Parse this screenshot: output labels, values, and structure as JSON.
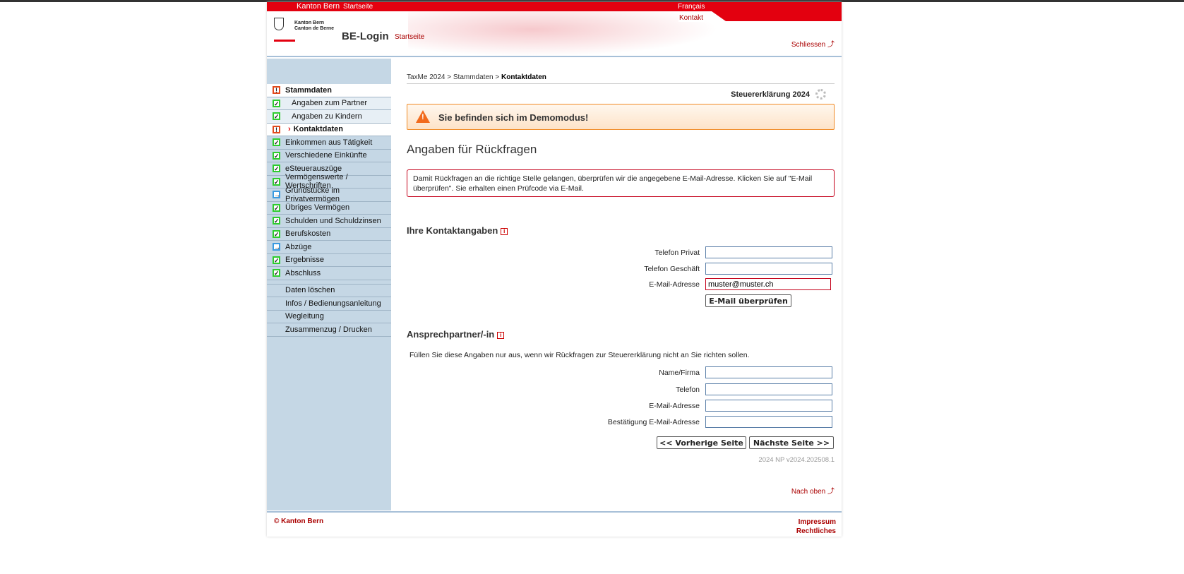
{
  "header": {
    "kanton": "Kanton Bern",
    "startseite": "Startseite",
    "language": "Français",
    "kontakt": "Kontakt",
    "logo_text_1": "Kanton Bern",
    "logo_text_2": "Canton de Berne",
    "app": "BE-Login",
    "app_start": "Startseite",
    "close": "Schliessen ⤴"
  },
  "sidebar": {
    "items": [
      {
        "label": "Stammdaten",
        "status": "warn"
      },
      {
        "label": "Angaben zum Partner",
        "status": "ok"
      },
      {
        "label": "Angaben zu Kindern",
        "status": "ok"
      },
      {
        "label": "Kontaktdaten",
        "status": "warn"
      },
      {
        "label": "Einkommen aus Tätigkeit",
        "status": "ok"
      },
      {
        "label": "Verschiedene Einkünfte",
        "status": "ok"
      },
      {
        "label": "eSteuerauszüge",
        "status": "ok"
      },
      {
        "label": "Vermögenswerte / Wertschriften",
        "status": "ok"
      },
      {
        "label": "Grundstücke im Privatvermögen",
        "status": "todo"
      },
      {
        "label": "Übriges Vermögen",
        "status": "ok"
      },
      {
        "label": "Schulden und Schuldzinsen",
        "status": "ok"
      },
      {
        "label": "Berufskosten",
        "status": "ok"
      },
      {
        "label": "Abzüge",
        "status": "todo"
      },
      {
        "label": "Ergebnisse",
        "status": "ok"
      },
      {
        "label": "Abschluss",
        "status": "ok"
      }
    ],
    "tools": [
      "Daten löschen",
      "Infos / Bedienungsanleitung",
      "Wegleitung",
      "Zusammenzug / Drucken"
    ]
  },
  "breadcrumb": {
    "a": "TaxMe 2024",
    "b": "Stammdaten",
    "c": "Kontaktdaten",
    "sep": " > "
  },
  "tax_year": "Steuererklärung 2024",
  "demo": "Sie befinden sich im Demomodus!",
  "title": "Angaben für Rückfragen",
  "alert": "Damit Rückfragen an die richtige Stelle gelangen, überprüfen wir die angegebene E-Mail-Adresse. Klicken Sie auf \"E-Mail überprüfen\". Sie erhalten einen Prüfcode via E-Mail.",
  "contact": {
    "heading": "Ihre Kontaktangaben",
    "phone_private": "Telefon Privat",
    "phone_private_value": "",
    "phone_business": "Telefon Geschäft",
    "phone_business_value": "",
    "email": "E-Mail-Adresse",
    "email_value": "muster@muster.ch",
    "verify": "E-Mail überprüfen"
  },
  "partner": {
    "heading": "Ansprechpartner/-in",
    "note": "Füllen Sie diese Angaben nur aus, wenn wir Rückfragen zur Steuererklärung nicht an Sie richten sollen.",
    "name": "Name/Firma",
    "phone": "Telefon",
    "email": "E-Mail-Adresse",
    "email_confirm": "Bestätigung E-Mail-Adresse"
  },
  "nav": {
    "prev": "<< Vorherige Seite",
    "next": "Nächste Seite >>"
  },
  "version": "2024 NP v2024.202508.1",
  "to_top": "Nach oben ⤴",
  "footer": {
    "copyright": "© Kanton Bern",
    "impressum": "Impressum",
    "legal": "Rechtliches"
  },
  "colors": {
    "brand_red": "#e3000f",
    "sidebar": "#c5d7e5",
    "demo_border": "#f08a24"
  }
}
